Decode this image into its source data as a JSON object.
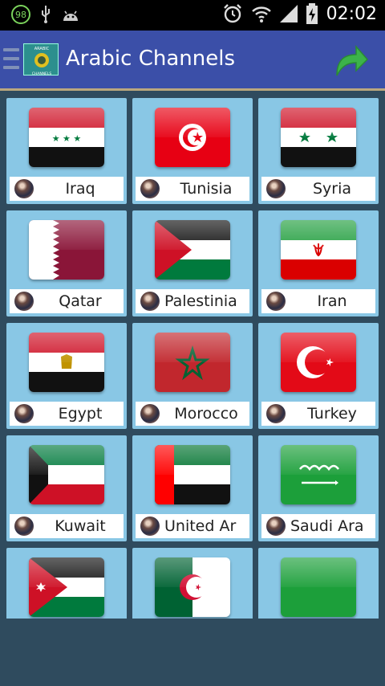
{
  "statusbar": {
    "badge": "98",
    "time": "02:02"
  },
  "appbar": {
    "title": "Arabic Channels",
    "logo_top": "ARABIC",
    "logo_bottom": "CHANNELS"
  },
  "countries": [
    {
      "name": "Iraq",
      "icon": "flag-iraq"
    },
    {
      "name": "Tunisia",
      "icon": "flag-tunisia"
    },
    {
      "name": "Syria",
      "icon": "flag-syria"
    },
    {
      "name": "Qatar",
      "icon": "flag-qatar"
    },
    {
      "name": "Palestinia",
      "icon": "flag-palestine"
    },
    {
      "name": "Iran",
      "icon": "flag-iran"
    },
    {
      "name": "Egypt",
      "icon": "flag-egypt"
    },
    {
      "name": "Morocco",
      "icon": "flag-morocco"
    },
    {
      "name": "Turkey",
      "icon": "flag-turkey"
    },
    {
      "name": "Kuwait",
      "icon": "flag-kuwait"
    },
    {
      "name": "United Ar",
      "icon": "flag-uae"
    },
    {
      "name": "Saudi Ara",
      "icon": "flag-saudi-arabia"
    },
    {
      "icon": "flag-jordan"
    },
    {
      "icon": "flag-algeria"
    },
    {
      "icon": "flag-libya"
    }
  ]
}
